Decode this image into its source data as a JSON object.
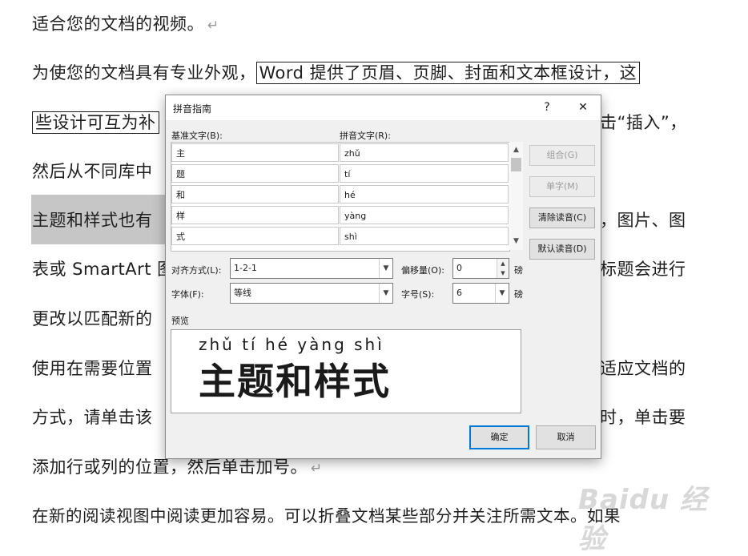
{
  "document": {
    "lines": [
      "适合您的文档的视频。",
      "为使您的文档具有专业外观，",
      "Word 提供了页眉、页脚、封面和文本框设计，这",
      "些设计可互为补",
      "击“插入”，",
      "然后从不同库中",
      "主题和样式也有",
      "，图片、图",
      "表或 SmartArt 图",
      "标题会进行",
      "更改以匹配新的",
      "使用在需要位置",
      "适应文档的",
      "方式，请单击该",
      "时，单击要",
      "添加行或列的位置，然后单击加号。",
      "在新的阅读视图中阅读更加容易。可以折叠文档某些部分并关注所需文本。如果"
    ],
    "return_mark": "↵"
  },
  "dialog": {
    "title": "拼音指南",
    "help": "?",
    "close": "✕",
    "base_label": "基准文字(B):",
    "ruby_label": "拼音文字(R):",
    "rows": [
      {
        "base": "主",
        "ruby": "zhǔ"
      },
      {
        "base": "题",
        "ruby": "tí"
      },
      {
        "base": "和",
        "ruby": "hé"
      },
      {
        "base": "样",
        "ruby": "yàng"
      },
      {
        "base": "式",
        "ruby": "shì"
      }
    ],
    "buttons": {
      "group": "组合(G)",
      "mono": "单字(M)",
      "clear": "清除读音(C)",
      "default": "默认读音(D)",
      "ok": "确定",
      "cancel": "取消"
    },
    "align_label": "对齐方式(L):",
    "align_value": "1-2-1",
    "offset_label": "偏移量(O):",
    "offset_value": "0",
    "offset_unit": "磅",
    "font_label": "字体(F):",
    "font_value": "等线",
    "size_label": "字号(S):",
    "size_value": "6",
    "size_unit": "磅",
    "preview_label": "预览",
    "preview_pinyin": "zhǔ tí hé yàng shì",
    "preview_text": "主题和样式"
  },
  "watermark": "Baidu 经验"
}
